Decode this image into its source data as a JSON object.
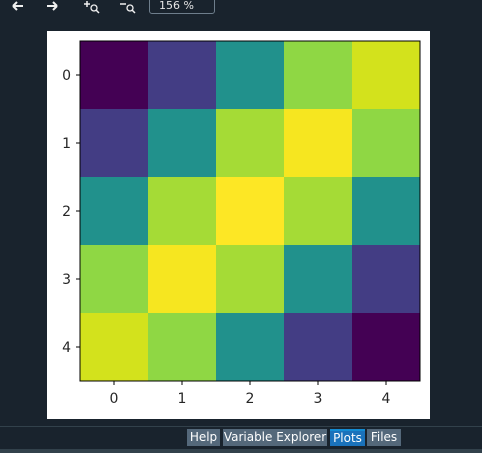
{
  "toolbar": {
    "back_icon": "arrow-left-icon",
    "forward_icon": "arrow-right-icon",
    "zoom_in_icon": "zoom-in-icon",
    "zoom_out_icon": "zoom-out-icon",
    "zoom_value": "156 %"
  },
  "tabs": [
    {
      "label": "Help",
      "active": false
    },
    {
      "label": "Variable Explorer",
      "active": false
    },
    {
      "label": "Plots",
      "active": true
    },
    {
      "label": "Files",
      "active": false
    }
  ],
  "colors": {
    "pane_background": "#19232d",
    "tab_background": "#54687a",
    "tab_active": "#1a72bb"
  },
  "chart_data": {
    "type": "heatmap",
    "colormap": "viridis",
    "x_ticks": [
      "0",
      "1",
      "2",
      "3",
      "4"
    ],
    "y_ticks": [
      "0",
      "1",
      "2",
      "3",
      "4"
    ],
    "values": [
      [
        0,
        1,
        2,
        3,
        4
      ],
      [
        1,
        2,
        3,
        4,
        3
      ],
      [
        2,
        3,
        4,
        3,
        2
      ],
      [
        3,
        4,
        3,
        2,
        1
      ],
      [
        4,
        3,
        2,
        1,
        0
      ]
    ],
    "cells": [
      [
        "#440154",
        "#433d84",
        "#21918c",
        "#8fd744",
        "#d3e21c"
      ],
      [
        "#433d84",
        "#21918c",
        "#a5db36",
        "#f6e620",
        "#8fd744"
      ],
      [
        "#21918c",
        "#a5db36",
        "#fde725",
        "#a5db36",
        "#21918c"
      ],
      [
        "#8fd744",
        "#f6e620",
        "#a5db36",
        "#21918c",
        "#433d84"
      ],
      [
        "#d3e21c",
        "#8fd744",
        "#21918c",
        "#433d84",
        "#440154"
      ]
    ]
  }
}
